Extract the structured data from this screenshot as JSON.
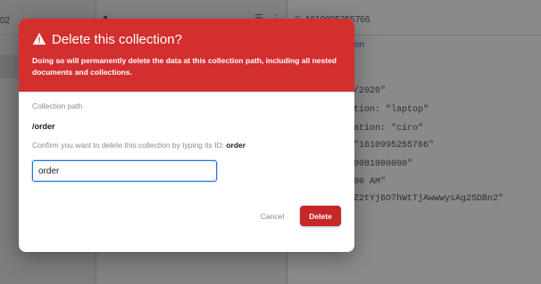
{
  "background": {
    "left_col_text": "02",
    "doc_id_text": "1610995255766",
    "link_text": "tion",
    "fields": [
      "/2020\"",
      "tion:  \"laptop\"",
      "ation:  \"ciro\"",
      "\"1610995255766\"",
      "0081000000\"",
      "00 AM\"",
      "Z2tYj6O7hWtTjAwwwysAg2SDBn2\""
    ]
  },
  "dialog": {
    "title": "Delete this collection?",
    "description": "Doing so will permanently delete the data at this collection path, including all nested documents and collections.",
    "path_label": "Collection path",
    "path_value": "/order",
    "confirm_text": "Confirm you want to delete this collection by typing its ID: ",
    "confirm_id": "order",
    "input_value": "order",
    "cancel_label": "Cancel",
    "delete_label": "Delete"
  },
  "colors": {
    "header": "#d32f2f",
    "delete_button": "#c62828",
    "input_border": "#1a73e8"
  },
  "icons": {
    "warning": "warning-icon"
  }
}
